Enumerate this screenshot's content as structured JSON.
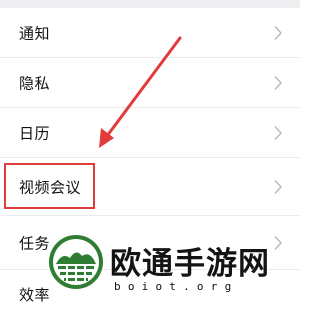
{
  "settings_list": {
    "items": [
      {
        "label": "通知"
      },
      {
        "label": "隐私"
      },
      {
        "label": "日历"
      },
      {
        "label": "视频会议"
      },
      {
        "label": "任务"
      },
      {
        "label": "效率"
      }
    ],
    "highlighted_item": "视频会议"
  },
  "annotation": {
    "color": "#e23b3b",
    "arrow_icon": "red-arrow-pointing-down-left"
  },
  "watermark": {
    "title": "欧通手游网",
    "domain": "boiot.org",
    "logo_icon": "green-globe-logo",
    "logo_color": "#2e7d32"
  }
}
